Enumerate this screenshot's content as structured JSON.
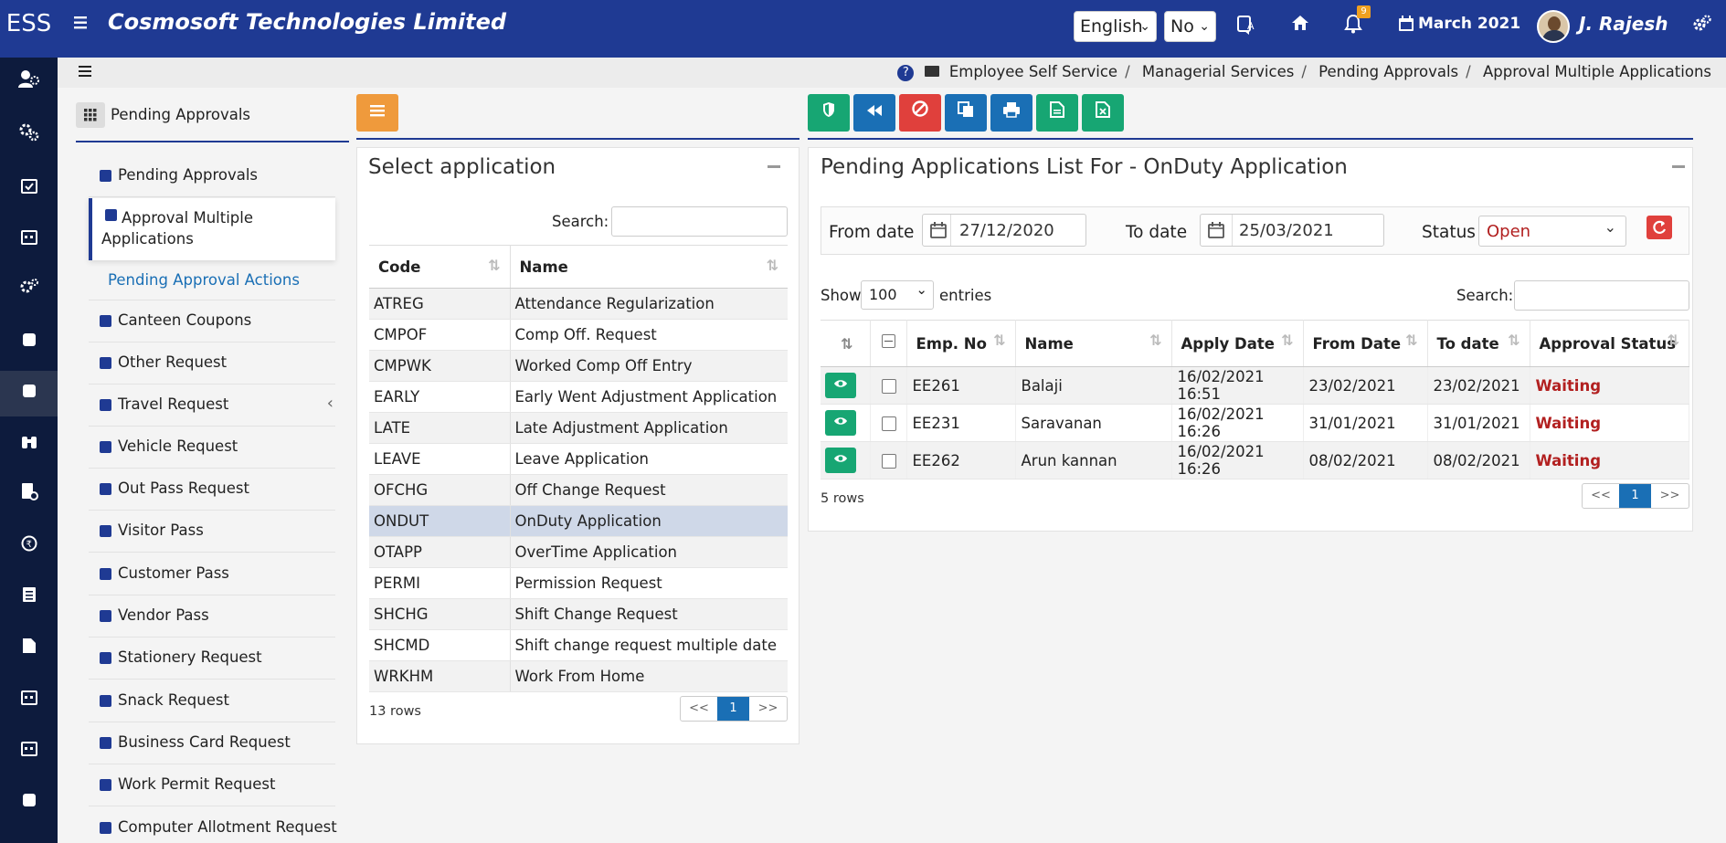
{
  "topbar": {
    "brand": "ESS",
    "company": "Cosmosoft Technologies Limited",
    "language": "English",
    "no_select": "No",
    "notifications_count": "9",
    "date": "March 2021",
    "user": "J. Rajesh"
  },
  "breadcrumb": [
    "Employee Self Service",
    "Managerial Services",
    "Pending Approvals",
    "Approval Multiple Applications"
  ],
  "submenu": {
    "title": "Pending Approvals",
    "items": [
      "Pending Approvals",
      "Approval Multiple Applications",
      "Pending Approval Actions",
      "Canteen Coupons",
      "Other Request",
      "Travel Request",
      "Vehicle Request",
      "Out Pass Request",
      "Visitor Pass",
      "Customer Pass",
      "Vendor Pass",
      "Stationery Request",
      "Snack Request",
      "Business Card Request",
      "Work Permit Request",
      "Computer Allotment Request"
    ]
  },
  "select_panel": {
    "title": "Select application",
    "search_label": "Search:",
    "columns": [
      "Code",
      "Name"
    ],
    "rows": [
      [
        "ATREG",
        "Attendance Regularization"
      ],
      [
        "CMPOF",
        "Comp Off. Request"
      ],
      [
        "CMPWK",
        "Worked Comp Off Entry"
      ],
      [
        "EARLY",
        "Early Went Adjustment Application"
      ],
      [
        "LATE",
        "Late Adjustment Application"
      ],
      [
        "LEAVE",
        "Leave Application"
      ],
      [
        "OFCHG",
        "Off Change Request"
      ],
      [
        "ONDUT",
        "OnDuty Application"
      ],
      [
        "OTAPP",
        "OverTime Application"
      ],
      [
        "PERMI",
        "Permission Request"
      ],
      [
        "SHCHG",
        "Shift Change Request"
      ],
      [
        "SHCMD",
        "Shift change request multiple date"
      ],
      [
        "WRKHM",
        "Work From Home"
      ]
    ],
    "row_count": "13 rows",
    "pager": {
      "prev": "<<",
      "page": "1",
      "next": ">>"
    }
  },
  "pending_panel": {
    "title": "Pending Applications List For - OnDuty Application",
    "from_label": "From date",
    "from_value": "27/12/2020",
    "to_label": "To date",
    "to_value": "25/03/2021",
    "status_label": "Status",
    "status_value": "Open",
    "show_label": "Show",
    "show_value": "100",
    "entries_label": "entries",
    "search_label": "Search:",
    "columns": [
      "Emp. No",
      "Name",
      "Apply Date",
      "From Date",
      "To date",
      "Approval Status"
    ],
    "rows": [
      [
        "EE261",
        "Balaji",
        "16/02/2021 16:51",
        "23/02/2021",
        "23/02/2021",
        "Waiting"
      ],
      [
        "EE231",
        "Saravanan",
        "16/02/2021 16:26",
        "31/01/2021",
        "31/01/2021",
        "Waiting"
      ],
      [
        "EE262",
        "Arun kannan",
        "16/02/2021 16:26",
        "08/02/2021",
        "08/02/2021",
        "Waiting"
      ]
    ],
    "row_count": "5 rows",
    "pager": {
      "prev": "<<",
      "page": "1",
      "next": ">>"
    }
  },
  "colors": {
    "topbar": "#1f3a93",
    "rail": "#0d1b3d",
    "orange_button": "#ef9a3c",
    "green_button": "#17a673",
    "blue_button": "#1a6fb5",
    "red_button": "#e0403c",
    "waiting": "#b22020"
  }
}
